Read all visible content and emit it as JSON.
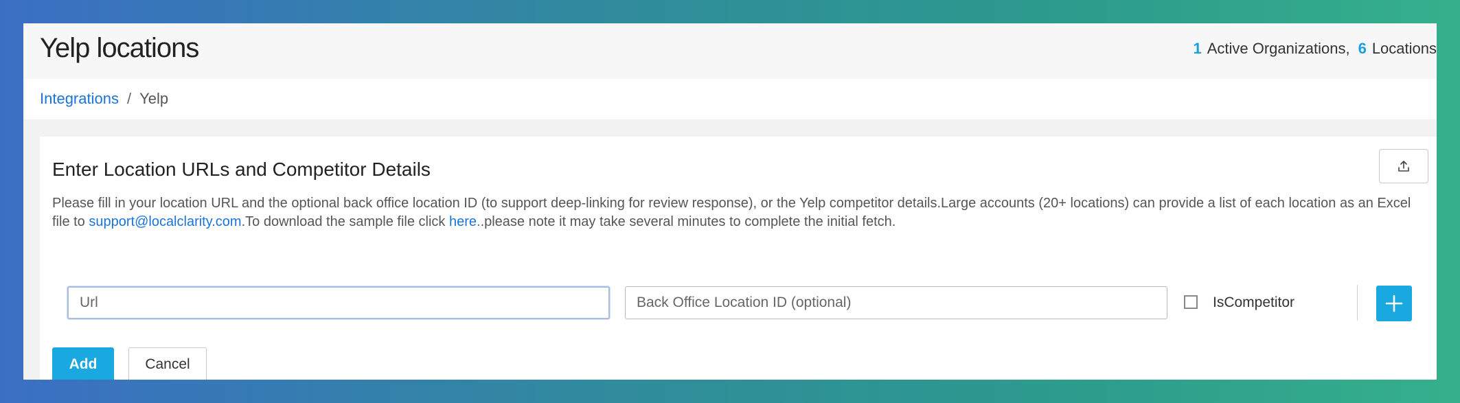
{
  "header": {
    "title": "Yelp locations",
    "stats": {
      "active_orgs_count": "1",
      "active_orgs_label": "Active Organizations,",
      "locations_count": "6",
      "locations_label": "Locations"
    }
  },
  "breadcrumb": {
    "parent": "Integrations",
    "separator": "/",
    "current": "Yelp"
  },
  "form": {
    "title": "Enter Location URLs and Competitor Details",
    "upload_icon": "upload-icon",
    "description": {
      "part1": "Please fill in your location URL and the optional back office location ID (to support deep-linking for review response), or the Yelp competitor details.Large accounts (20+ locations) can provide a list of each location as an Excel file to ",
      "email": "support@localclarity.com",
      "part2": ".To download the sample file click ",
      "here": "here.",
      "part3": ".please note it may take several minutes to complete the initial fetch."
    },
    "url_placeholder": "Url",
    "url_value": "",
    "office_placeholder": "Back Office Location ID (optional)",
    "office_value": "",
    "checkbox_label": "IsCompetitor",
    "add_row_icon": "plus-icon",
    "add_label": "Add",
    "cancel_label": "Cancel"
  },
  "colors": {
    "accent": "#1aa8e0",
    "link": "#1a73d9"
  }
}
